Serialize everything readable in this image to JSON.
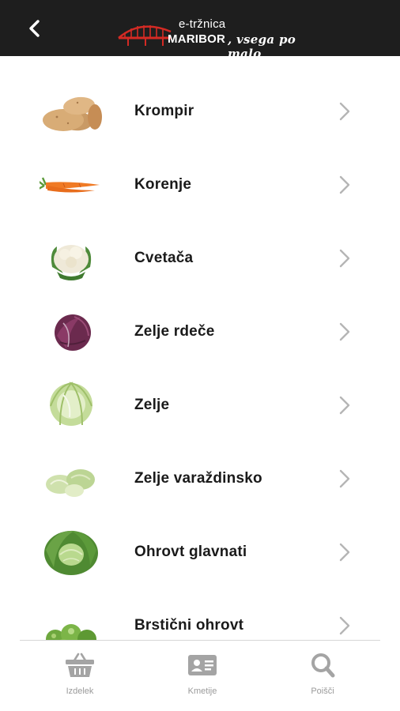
{
  "header": {
    "back_icon": "chevron-left-icon",
    "logo": {
      "top_text": "e-tržnica",
      "main_text": "MARIBOR",
      "tagline": ", vsega po malo"
    }
  },
  "products": [
    {
      "name": "Krompir",
      "icon": "potato"
    },
    {
      "name": "Korenje",
      "icon": "carrot"
    },
    {
      "name": "Cvetača",
      "icon": "cauliflower"
    },
    {
      "name": "Zelje rdeče",
      "icon": "red-cabbage"
    },
    {
      "name": "Zelje",
      "icon": "cabbage"
    },
    {
      "name": "Zelje varaždinsko",
      "icon": "varazdin-cabbage"
    },
    {
      "name": "Ohrovt glavnati",
      "icon": "savoy-cabbage"
    },
    {
      "name": "Brstični ohrovt",
      "icon": "brussels-sprouts"
    }
  ],
  "tabbar": {
    "tabs": [
      {
        "label": "Izdelek",
        "icon": "basket-icon"
      },
      {
        "label": "Kmetije",
        "icon": "id-card-icon"
      },
      {
        "label": "Poišči",
        "icon": "search-icon"
      }
    ]
  },
  "colors": {
    "header_bg": "#1e1e1e",
    "brand_red": "#d42a24",
    "text": "#1a1a1a",
    "muted": "#9a9a9a",
    "chevron": "#b5b5b5"
  }
}
